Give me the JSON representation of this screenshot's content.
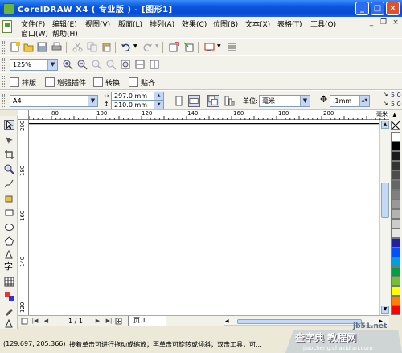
{
  "window": {
    "title": "CorelDRAW X4 ( 专业版 ) - [图形1]",
    "buttons": {
      "minimize": "_",
      "maximize": "□",
      "close": "×"
    }
  },
  "menu": {
    "items": [
      "文件(F)",
      "编辑(E)",
      "视图(V)",
      "版面(L)",
      "排列(A)",
      "效果(C)",
      "位图(B)",
      "文本(X)",
      "表格(T)",
      "工具(O)",
      "窗口(W)",
      "帮助(H)"
    ]
  },
  "zoom": {
    "value": "125%"
  },
  "plugins": {
    "items": [
      "排版",
      "增强插件",
      "转换",
      "贴齐"
    ]
  },
  "property_bar": {
    "paper_size": "A4",
    "width": "297.0 mm",
    "height": "210.0 mm",
    "unit_label": "单位:",
    "unit_value": "毫米",
    "nudge": ".1mm",
    "dup_x": "5.0",
    "dup_y": "5.0"
  },
  "ruler": {
    "h_ticks": [
      "80",
      "100",
      "120",
      "140",
      "160",
      "180",
      "200"
    ],
    "unit": "毫米",
    "v_ticks": [
      "200",
      "180",
      "160",
      "140",
      "120"
    ]
  },
  "palette": {
    "colors": [
      "#ffffff",
      "#000000",
      "#1a1a1a",
      "#333333",
      "#4d4d4d",
      "#666666",
      "#808080",
      "#999999",
      "#b3b3b3",
      "#cccccc",
      "#e6e6e6",
      "#2020a0",
      "#0050ff",
      "#00a0e0",
      "#00a040",
      "#70c030",
      "#ffff00",
      "#ff8000",
      "#ff0000"
    ]
  },
  "page_nav": {
    "counter": "1 / 1",
    "tab": "页 1"
  },
  "status": {
    "coords": "(129.697, 205.366)",
    "hint": "接着单击可进行拖动或缩放；再单击可旋转或倾斜；双击工具，可..."
  },
  "watermark": {
    "line1": "jb51.net",
    "line2": "查字典 教程网",
    "line3": "jiaocheng.chazidian.com"
  }
}
